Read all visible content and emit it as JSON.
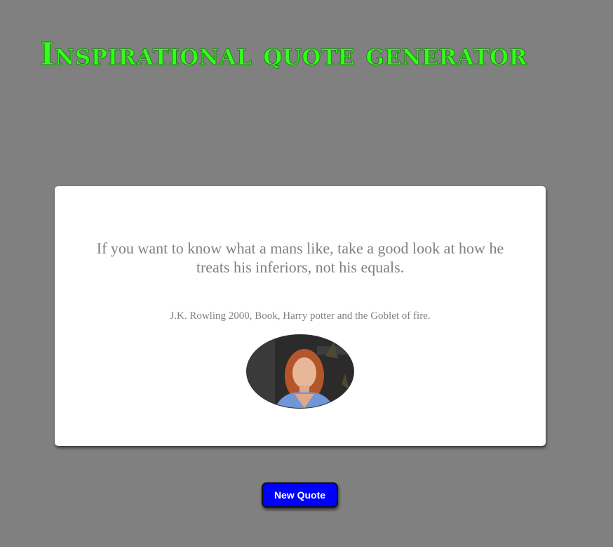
{
  "header": {
    "title": "Inspirational quote generator",
    "title_color": "#34ff1a"
  },
  "quote": {
    "text": "If you want to know what a mans like, take a good look at how he treats his inferiors, not his equals.",
    "source": "J.K. Rowling 2000, Book, Harry potter and the Goblet of fire.",
    "text_color": "#808080"
  },
  "author_photo": {
    "alt": "J.K. Rowling"
  },
  "actions": {
    "new_quote_label": "New Quote",
    "button_color": "#0000ff"
  },
  "page": {
    "background": "#808080",
    "card_background": "#ffffff"
  }
}
